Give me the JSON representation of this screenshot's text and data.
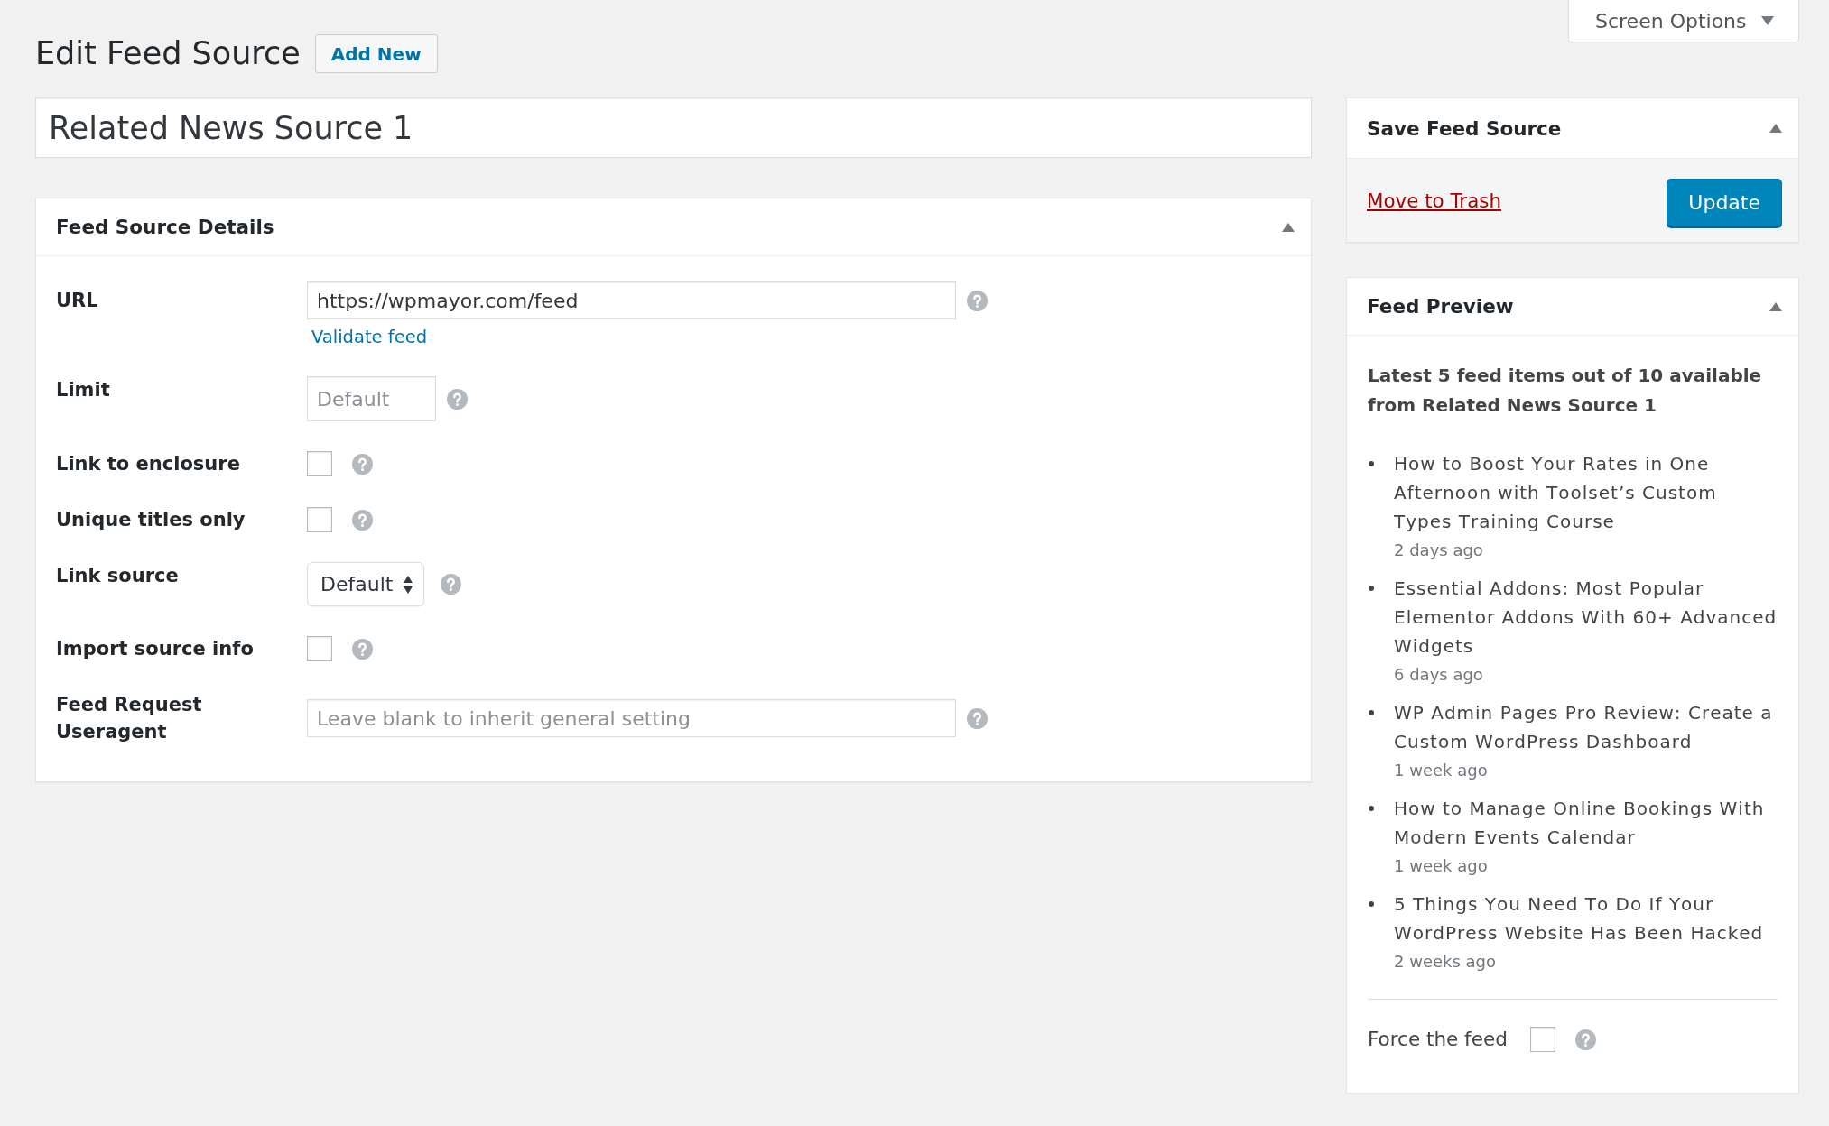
{
  "screen_options": {
    "label": "Screen Options"
  },
  "header": {
    "title": "Edit Feed Source",
    "add_new_button": "Add New"
  },
  "title_field": {
    "value": "Related News Source 1"
  },
  "details_panel": {
    "title": "Feed Source Details",
    "expanded": true,
    "fields": [
      {
        "kind": "text",
        "label": "URL",
        "value": "https://wpmayor.com/feed",
        "link": "Validate feed"
      },
      {
        "kind": "number",
        "label": "Limit",
        "placeholder": "Default"
      },
      {
        "kind": "checkbox",
        "label": "Link to enclosure",
        "checked": false
      },
      {
        "kind": "checkbox",
        "label": "Unique titles only",
        "checked": false
      },
      {
        "kind": "select",
        "label": "Link source",
        "value": "Default"
      },
      {
        "kind": "checkbox",
        "label": "Import source info",
        "checked": false
      },
      {
        "kind": "text",
        "label": "Feed Request Useragent",
        "placeholder": "Leave blank to inherit general setting"
      }
    ]
  },
  "save_panel": {
    "title": "Save Feed Source",
    "expanded": true,
    "trash_link": "Move to Trash",
    "update_button": "Update"
  },
  "preview_panel": {
    "title": "Feed Preview",
    "expanded": true,
    "summary": "Latest 5 feed items out of 10 available from Related News Source 1",
    "items": [
      {
        "title": "How to Boost Your Rates in One Afternoon with Toolset’s Custom Types Training Course",
        "age": "2 days ago"
      },
      {
        "title": "Essential Addons: Most Popular Elementor Addons With 60+ Advanced Widgets",
        "age": "6 days ago"
      },
      {
        "title": "WP Admin Pages Pro Review: Create a Custom WordPress Dashboard",
        "age": "1 week ago"
      },
      {
        "title": "How to Manage Online Bookings With Modern Events Calendar",
        "age": "1 week ago"
      },
      {
        "title": "5 Things You Need To Do If Your WordPress Website Has Been Hacked",
        "age": "2 weeks ago"
      }
    ],
    "force_feed": {
      "label": "Force the feed",
      "checked": false
    }
  }
}
